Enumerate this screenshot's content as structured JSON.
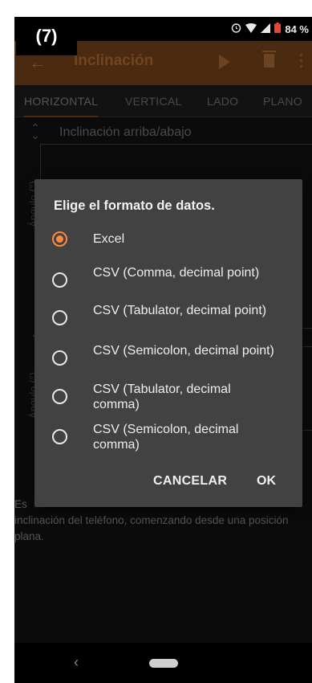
{
  "step_badge": "(7)",
  "status_bar": {
    "battery": "84 %"
  },
  "app_bar": {
    "title": "Inclinación",
    "back_icon": "arrow-left-icon",
    "play_icon": "play-icon",
    "delete_icon": "trash-icon",
    "more_icon": "more-vert-icon"
  },
  "tabs": [
    {
      "label": "HORIZONTAL"
    },
    {
      "label": "VERTICAL"
    },
    {
      "label": "LADO"
    },
    {
      "label": "PLANO"
    }
  ],
  "background": {
    "section1_title": "Inclinación arriba/abajo",
    "axis_label_1": "Ángulo (°)",
    "axis_label_2": "Ángulo (°)",
    "description_visible": "Es",
    "description_rest": "inclinación del teléfono, comenzando desde una posición plana."
  },
  "dialog": {
    "title": "Elige el formato de datos.",
    "options": [
      {
        "label": "Excel",
        "selected": true
      },
      {
        "label": "CSV (Comma, decimal point)",
        "selected": false
      },
      {
        "label": "CSV (Tabulator, decimal point)",
        "selected": false
      },
      {
        "label": "CSV (Semicolon, decimal point)",
        "selected": false
      },
      {
        "label": "CSV (Tabulator, decimal comma)",
        "selected": false
      },
      {
        "label": "CSV (Semicolon, decimal comma)",
        "selected": false
      }
    ],
    "cancel_label": "CANCELAR",
    "ok_label": "OK"
  },
  "colors": {
    "accent": "#ff8a3d",
    "app_bar": "#4a2a10",
    "dialog_bg": "#424242"
  }
}
